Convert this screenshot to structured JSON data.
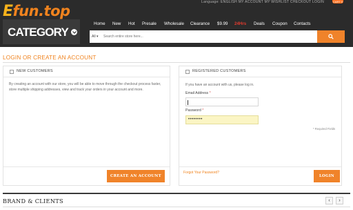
{
  "header": {
    "logo": {
      "e": "E",
      "rest": "fun.top"
    },
    "top_links": "Language: ENGLISH   MY ACCOUNT   MY WISHLIST   CHECKOUT   LOGIN",
    "cart_count": "CART 0",
    "nav": [
      "Home",
      "New",
      "Hot",
      "Presale",
      "Wholesale",
      "Clearance",
      "$9.99",
      "24Hrs",
      "Deals",
      "Coupon",
      "Contacts"
    ],
    "category_label": "CATEGORY",
    "search": {
      "scope": "All",
      "placeholder": "Search entire store here..."
    }
  },
  "page": {
    "title": "LOGIN OR CREATE AN ACCOUNT"
  },
  "new_customers": {
    "heading": "NEW CUSTOMERS",
    "description": "By creating an account with our store, you will be able to move through the checkout process faster, store multiple shipping addresses, view and track your orders in your account and more.",
    "button": "CREATE AN ACCOUNT"
  },
  "registered_customers": {
    "heading": "REGISTERED CUSTOMERS",
    "description": "If you have an account with us, please log in.",
    "email_label": "Email Address",
    "password_label": "Password",
    "required_mark": "*",
    "email_value": "",
    "password_value": "••••••••",
    "required_note": "* Required Fields",
    "forgot_link": "Forgot Your Password?",
    "button": "LOGIN"
  },
  "brand_section": {
    "title": "BRAND & CLIENTS",
    "prev": "‹",
    "next": "›"
  },
  "colors": {
    "accent": "#f0832a",
    "header_bg": "#2b2b2b",
    "hot": "#e33b2e"
  }
}
